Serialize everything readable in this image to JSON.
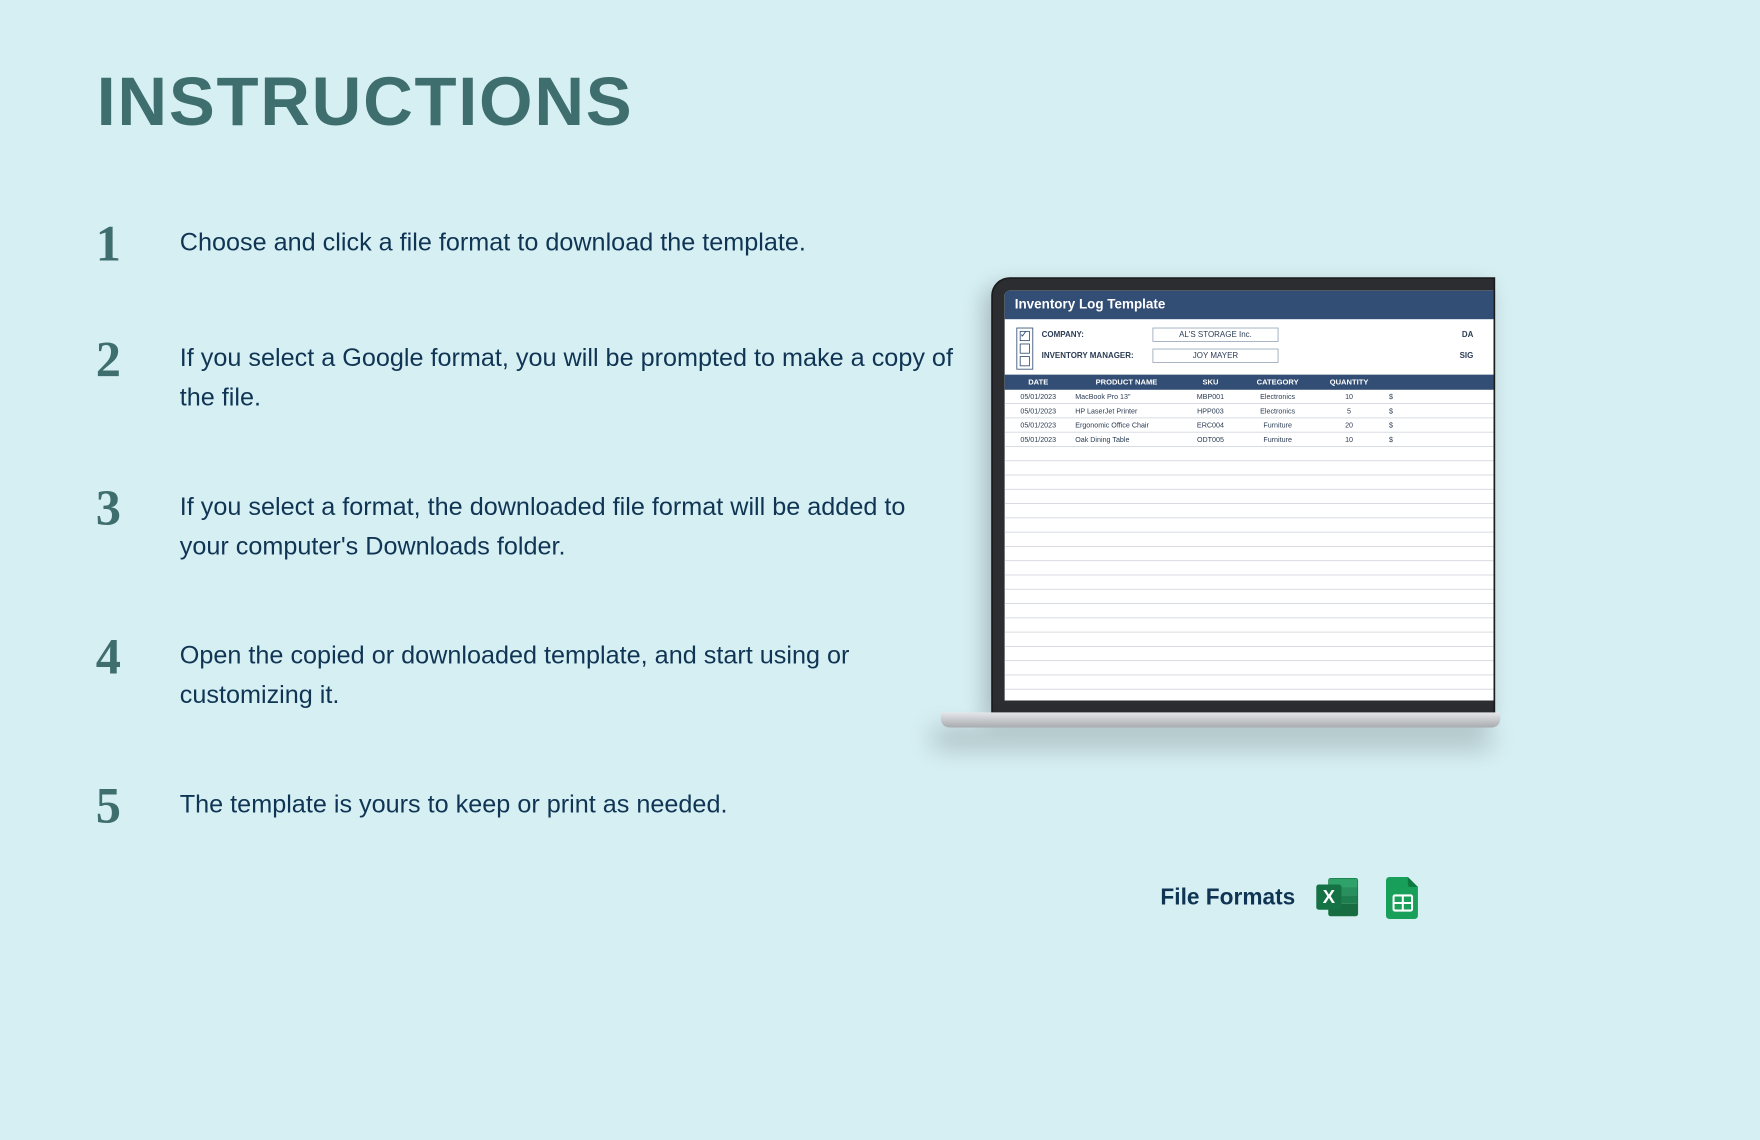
{
  "title": "INSTRUCTIONS",
  "steps": [
    {
      "num": "1",
      "text": "Choose and click a file format to download the template."
    },
    {
      "num": "2",
      "text": "If you select a Google format, you will be prompted to make a copy of the file."
    },
    {
      "num": "3",
      "text": "If you select a format, the downloaded file format will be added to your computer's Downloads folder."
    },
    {
      "num": "4",
      "text": "Open the copied or downloaded template, and start using or customizing it."
    },
    {
      "num": "5",
      "text": "The template is yours to keep or print as needed."
    }
  ],
  "preview": {
    "title": "Inventory Log Template",
    "company_label": "COMPANY:",
    "company_value": "AL'S STORAGE Inc.",
    "manager_label": "INVENTORY MANAGER:",
    "manager_value": "JOY MAYER",
    "date_label": "DA",
    "sig_label": "SIG",
    "columns": [
      "DATE",
      "PRODUCT NAME",
      "SKU",
      "CATEGORY",
      "QUANTITY",
      ""
    ],
    "rows": [
      {
        "date": "05/01/2023",
        "product": "MacBook Pro 13\"",
        "sku": "MBP001",
        "category": "Electronics",
        "qty": "10",
        "tail": "$"
      },
      {
        "date": "05/01/2023",
        "product": "HP LaserJet Printer",
        "sku": "HPP003",
        "category": "Electronics",
        "qty": "5",
        "tail": "$"
      },
      {
        "date": "05/01/2023",
        "product": "Ergonomic Office Chair",
        "sku": "ERC004",
        "category": "Furniture",
        "qty": "20",
        "tail": "$"
      },
      {
        "date": "05/01/2023",
        "product": "Oak Dining Table",
        "sku": "ODT005",
        "category": "Furniture",
        "qty": "10",
        "tail": "$"
      }
    ]
  },
  "file_formats": {
    "label": "File Formats",
    "excel_letter": "X",
    "sheets_letter": ""
  }
}
